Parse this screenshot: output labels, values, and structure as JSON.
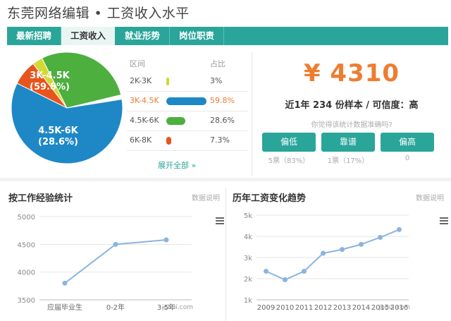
{
  "page": {
    "title": "东莞网络编辑 • 工资收入水平"
  },
  "tabs": [
    {
      "label": "最新招聘"
    },
    {
      "label": "工资收入"
    },
    {
      "label": "就业形势"
    },
    {
      "label": "岗位职责"
    }
  ],
  "pie": {
    "label_big": "3K-4.5K",
    "label_big_pct": "(59.8%)",
    "label_mid": "4.5K-6K",
    "label_mid_pct": "(28.6%)"
  },
  "distribution": {
    "col_range": "区间",
    "col_share": "占比",
    "rows": [
      {
        "range": "2K-3K",
        "pct": "3%",
        "share": 0.03,
        "color": "#d4d832"
      },
      {
        "range": "3K-4.5K",
        "pct": "59.8%",
        "share": 0.598,
        "color": "#1e88c7"
      },
      {
        "range": "4.5K-6K",
        "pct": "28.6%",
        "share": 0.286,
        "color": "#4caf3e"
      },
      {
        "range": "6K-8K",
        "pct": "7.3%",
        "share": 0.073,
        "color": "#e8541e"
      }
    ],
    "expand_label": "展开全部 »"
  },
  "summary": {
    "salary": "¥ 4310",
    "sample_text": "近1年 234 份样本 / 可信度：高",
    "question": "你觉得该统计数据准确吗?",
    "votes": [
      {
        "label": "偏低",
        "count": "5票（83%）"
      },
      {
        "label": "靠谱",
        "count": "1票（17%）"
      },
      {
        "label": "偏高",
        "count": "0"
      }
    ]
  },
  "experience_panel": {
    "title": "按工作经验统计",
    "link": "数据说明",
    "watermark": "jobui.com"
  },
  "trend_panel": {
    "title": "历年工资变化趋势",
    "link": "数据说明",
    "watermark": "jobui.com"
  },
  "chart_data": [
    {
      "type": "line",
      "categories": [
        "应届毕业生",
        "0-2年",
        "3-5年"
      ],
      "values": [
        3800,
        4500,
        4580
      ],
      "ylim": [
        3500,
        5000
      ],
      "yticks": [
        "3500",
        "4000",
        "4500",
        "5000"
      ],
      "grid": true,
      "color": "#8ab4de"
    },
    {
      "type": "line",
      "categories": [
        "2009",
        "2010",
        "2011",
        "2012",
        "2013",
        "2014",
        "2015",
        "2016"
      ],
      "values": [
        2350,
        1950,
        2350,
        3200,
        3380,
        3620,
        3950,
        4320
      ],
      "ylim": [
        1000,
        5000
      ],
      "yticks": [
        "1k",
        "2k",
        "3k",
        "4k",
        "5k"
      ],
      "grid": true,
      "color": "#8ab4de"
    }
  ]
}
